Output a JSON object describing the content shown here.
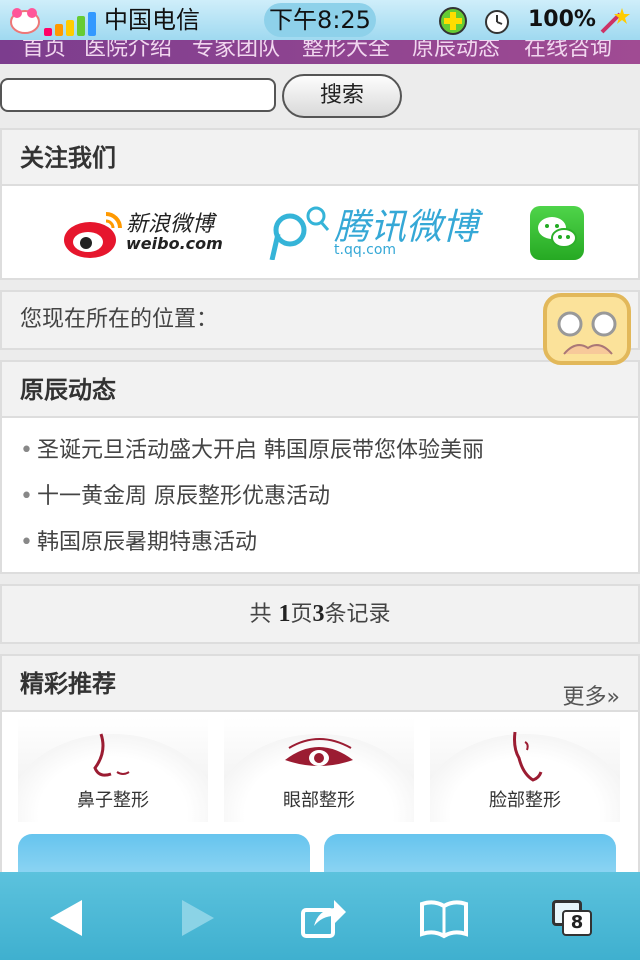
{
  "status_bar": {
    "carrier": "中国电信",
    "time": "下午8:25",
    "battery": "100%"
  },
  "nav": {
    "items": [
      "首页",
      "医院介绍",
      "专家团队",
      "整形大全",
      "原辰动态",
      "在线咨询"
    ]
  },
  "search": {
    "value": "",
    "button_label": "搜索"
  },
  "follow": {
    "title": "关注我们",
    "sina_name": "新浪微博",
    "sina_url": "weibo.com",
    "tencent_name": "腾讯微博",
    "tencent_url": "t.qq.com"
  },
  "location": {
    "label": "您现在所在的位置："
  },
  "news": {
    "title": "原辰动态",
    "items": [
      "圣诞元旦活动盛大开启 韩国原辰带您体验美丽",
      "十一黄金周 原辰整形优惠活动",
      "韩国原辰暑期特惠活动"
    ]
  },
  "pager": {
    "prefix": "共 ",
    "pages": "1",
    "pages_suffix": "页",
    "records": "3",
    "records_suffix": "条记录"
  },
  "featured": {
    "title": "精彩推荐",
    "more": "更多»",
    "cards": [
      {
        "label": "鼻子整形",
        "icon": "nose-icon"
      },
      {
        "label": "眼部整形",
        "icon": "eye-icon"
      },
      {
        "label": "脸部整形",
        "icon": "face-icon"
      }
    ]
  },
  "toolbar": {
    "tabs_count": "8"
  },
  "colors": {
    "nav_bg": "#8a4390",
    "toolbar_bg": "#4bb8d6",
    "status_bg": "#b5e3f4",
    "accent_red": "#c0152e"
  }
}
